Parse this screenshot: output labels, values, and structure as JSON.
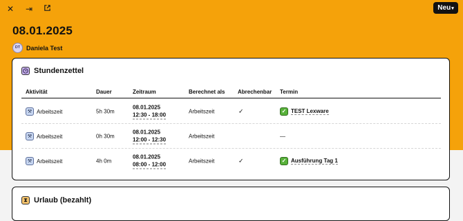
{
  "toolbar": {
    "close_icon": "close-icon",
    "expand_icon": "arrow-right-to-bar-icon",
    "open_icon": "external-link-icon",
    "new_button_label": "Neu",
    "new_caret": "▾"
  },
  "header": {
    "date": "08.01.2025",
    "owner_initials": "DT",
    "owner_name": "Daniela Test"
  },
  "timesheet": {
    "title": "Stundenzettel",
    "icon": "clock-icon",
    "columns": [
      "Aktivität",
      "Dauer",
      "Zeitraum",
      "Berechnet als",
      "Abrechenbar",
      "Termin"
    ],
    "rows": [
      {
        "activity": "Arbeitszeit",
        "duration": "5h 30m",
        "date": "08.01.2025",
        "time": "12:30 - 18:00",
        "billed_as": "Arbeitszeit",
        "billable": "✓",
        "appointment": "TEST Lexware",
        "has_appointment": true
      },
      {
        "activity": "Arbeitszeit",
        "duration": "0h 30m",
        "date": "08.01.2025",
        "time": "12:00 - 12:30",
        "billed_as": "Arbeitszeit",
        "billable": "",
        "appointment": "—",
        "has_appointment": false
      },
      {
        "activity": "Arbeitszeit",
        "duration": "4h 0m",
        "date": "08.01.2025",
        "time": "08:00 - 12:00",
        "billed_as": "Arbeitszeit",
        "billable": "✓",
        "appointment": "Ausführung Tag 1",
        "has_appointment": true
      }
    ]
  },
  "vacation": {
    "title": "Urlaub (bezahlt)",
    "icon": "hourglass-icon"
  },
  "colors": {
    "banner": "#f5a20a",
    "button": "#121212",
    "appointment_check": "#58b13a"
  }
}
